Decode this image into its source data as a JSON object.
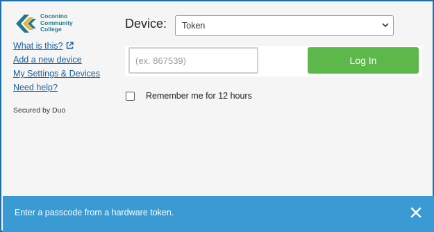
{
  "logo": {
    "lines": [
      "Coconino",
      "Community",
      "College"
    ],
    "icon": "chevron-logo-icon"
  },
  "sidebar": {
    "links": [
      {
        "label": "What is this?",
        "icon": "external-link-icon"
      },
      {
        "label": "Add a new device"
      },
      {
        "label": "My Settings & Devices"
      },
      {
        "label": "Need help?"
      }
    ],
    "secured_text": "Secured by Duo"
  },
  "device": {
    "label": "Device:",
    "selected": "Token",
    "icon": "chevron-down-icon"
  },
  "passcode": {
    "placeholder": "(ex. 867539)",
    "value": ""
  },
  "login": {
    "label": "Log In"
  },
  "remember": {
    "label": "Remember me for 12 hours",
    "checked": false
  },
  "banner": {
    "message": "Enter a passcode from a hardware token.",
    "close_icon": "close-icon"
  },
  "colors": {
    "frame_border": "#1f6fa8",
    "background": "#f5f5f5",
    "login_button": "#5db84c",
    "banner": "#3a9bd4",
    "link": "#1a5f96",
    "logo_teal": "#1f7a8c",
    "logo_gold": "#e7b23c"
  }
}
